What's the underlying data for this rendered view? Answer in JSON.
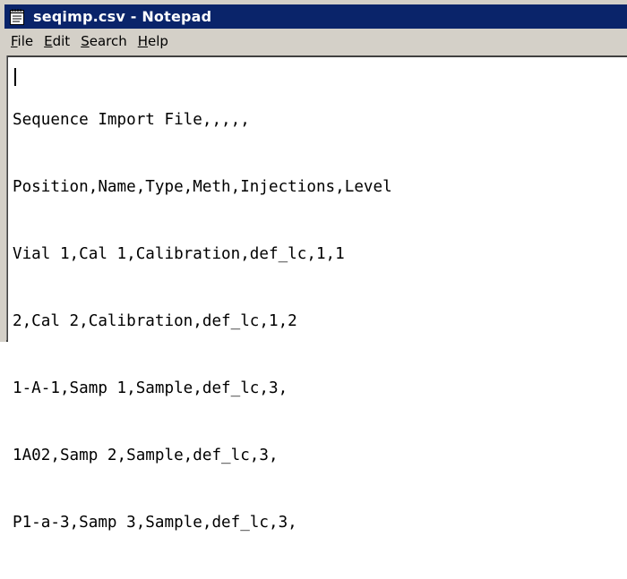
{
  "window": {
    "title": "seqimp.csv - Notepad",
    "titlebar_color": "#0a246a",
    "chrome_color": "#d4d0c8"
  },
  "app_icon": "notepad-icon",
  "menu": {
    "items": [
      {
        "mnemonic": "F",
        "rest": "ile"
      },
      {
        "mnemonic": "E",
        "rest": "dit"
      },
      {
        "mnemonic": "S",
        "rest": "earch"
      },
      {
        "mnemonic": "H",
        "rest": "elp"
      }
    ]
  },
  "document": {
    "lines": [
      "Sequence Import File,,,,,",
      "Position,Name,Type,Meth,Injections,Level",
      "Vial 1,Cal 1,Calibration,def_lc,1,1",
      "2,Cal 2,Calibration,def_lc,1,2",
      "1-A-1,Samp 1,Sample,def_lc,3,",
      "1A02,Samp 2,Sample,def_lc,3,",
      "P1-a-3,Samp 3,Sample,def_lc,3,"
    ]
  }
}
